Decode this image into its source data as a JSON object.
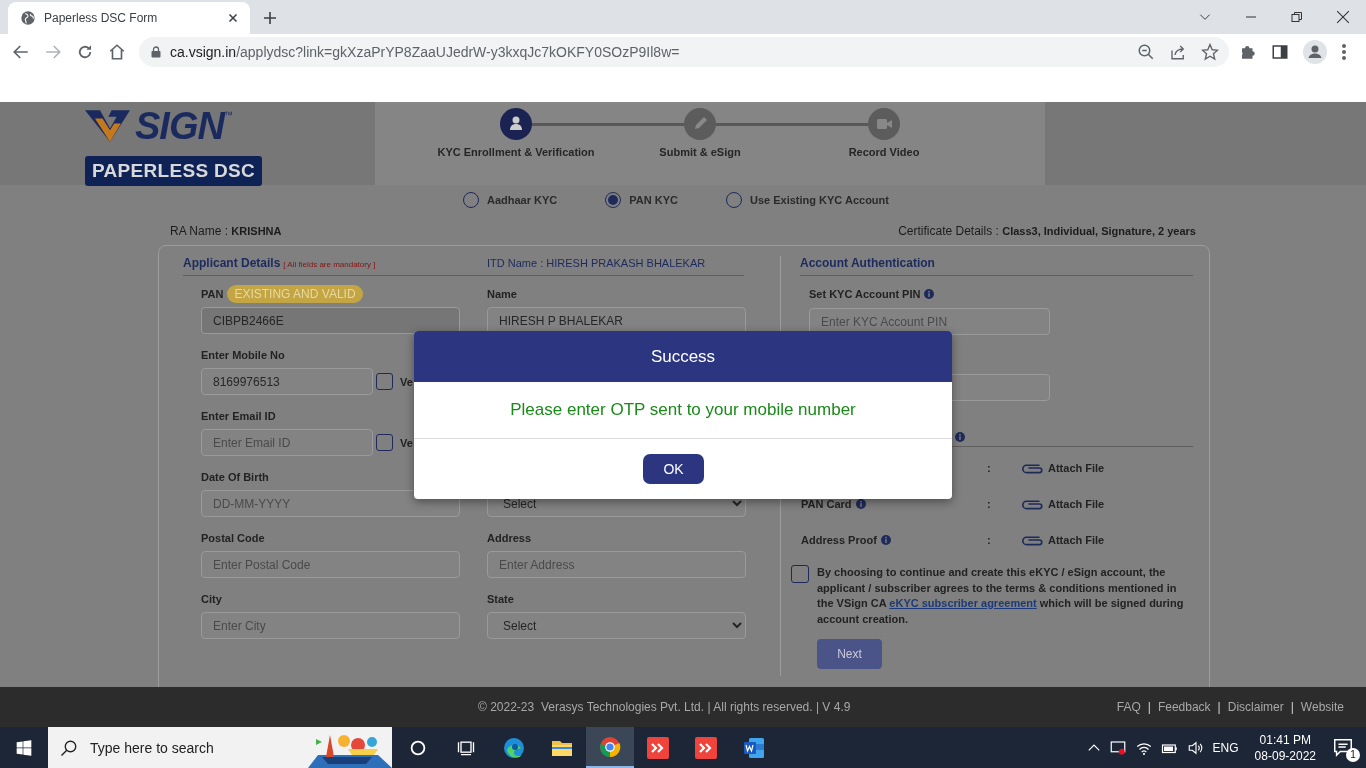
{
  "browser": {
    "tab_title": "Paperless DSC Form",
    "url_host": "ca.vsign.in",
    "url_path": "/applydsc?link=gkXzaPrYP8ZaaUJedrW-y3kxqJc7kOKFY0SOzP9Il8w="
  },
  "logo": {
    "word": "SIGN",
    "trademark": "™",
    "tagline": "PAPERLESS DSC"
  },
  "steps": [
    {
      "kind": "person",
      "label": "KYC Enrollment & Verification",
      "active": true
    },
    {
      "kind": "pencil",
      "label": "Submit & eSign",
      "active": false
    },
    {
      "kind": "camera",
      "label": "Record Video",
      "active": false
    }
  ],
  "kyc_options": [
    {
      "label": "Aadhaar KYC",
      "selected": false
    },
    {
      "label": "PAN KYC",
      "selected": true
    },
    {
      "label": "Use Existing KYC Account",
      "selected": false
    }
  ],
  "ra": {
    "label": "RA Name : ",
    "value": "KRISHNA"
  },
  "certificate": {
    "label": "Certificate Details : ",
    "value": "Class3, Individual, Signature, 2 years"
  },
  "applicant": {
    "title": "Applicant Details",
    "note": "[ All fields are mandatory ]",
    "itd_label": "ITD Name : ",
    "itd_value": "HIRESH PRAKASH BHALEKAR"
  },
  "left_fields": [
    {
      "kind": "input",
      "label": "PAN",
      "badge": "EXISTING AND VALID",
      "value": "CIBPB2466E",
      "disabled": true
    },
    {
      "kind": "input",
      "label": "Enter Mobile No",
      "value": "8169976513",
      "disabled": false,
      "verify": {
        "label": "Ve",
        "checked": false
      }
    },
    {
      "kind": "input",
      "label": "Enter Email ID",
      "placeholder": "Enter Email ID",
      "disabled": false,
      "verify": {
        "label": "Ve",
        "checked": false
      }
    },
    {
      "kind": "input",
      "label": "Date Of Birth",
      "placeholder": "DD-MM-YYYY",
      "disabled": false
    },
    {
      "kind": "input",
      "label": "Postal Code",
      "placeholder": "Enter Postal Code",
      "disabled": false
    },
    {
      "kind": "input",
      "label": "City",
      "placeholder": "Enter City",
      "disabled": false
    }
  ],
  "right_fields": [
    {
      "kind": "input",
      "label": "Name",
      "value": "HIRESH P BHALEKAR",
      "disabled": false
    },
    {
      "kind": "select",
      "value": "Select"
    },
    {
      "kind": "input",
      "label": "Address",
      "placeholder": "Enter Address",
      "disabled": false
    },
    {
      "kind": "select",
      "label": "State",
      "value": "Select"
    }
  ],
  "account": {
    "title": "Account Authentication",
    "pin_label": "Set KYC Account PIN",
    "pin_placeholder": "Enter KYC Account PIN"
  },
  "documents": [
    {
      "separator": ":",
      "attach": "Attach File"
    },
    {
      "label": "PAN Card",
      "separator": ":",
      "attach": "Attach File"
    },
    {
      "label": "Address Proof",
      "separator": ":",
      "attach": "Attach File"
    }
  ],
  "consent": {
    "checked": false,
    "text": "By choosing to continue and create this eKYC / eSign account, the applicant / subscriber agrees to the terms & conditions mentioned in the VSign CA ",
    "link": "eKYC subscriber agreement",
    "text_after": " which will be signed during account creation."
  },
  "next_button": {
    "label": "Next",
    "disabled": true
  },
  "modal": {
    "title": "Success",
    "message": "Please enter OTP sent to your mobile number",
    "button": "OK"
  },
  "footer": {
    "copyright": "© 2022-23  Verasys Technologies Pvt. Ltd. | All rights reserved. | V 4.9",
    "items": [
      {
        "kind": "link",
        "text": "FAQ"
      },
      {
        "kind": "separator",
        "text": "|"
      },
      {
        "kind": "link",
        "text": "Feedback"
      },
      {
        "kind": "separator",
        "text": "|"
      },
      {
        "kind": "link",
        "text": "Disclaimer"
      },
      {
        "kind": "separator",
        "text": "|"
      },
      {
        "kind": "link",
        "text": "Website"
      }
    ]
  },
  "taskbar": {
    "search_placeholder": "Type here to search",
    "apps": [
      {
        "kind": "cortana",
        "active": false
      },
      {
        "kind": "taskview",
        "active": false
      },
      {
        "kind": "edge",
        "active": false
      },
      {
        "kind": "explorer",
        "active": false
      },
      {
        "kind": "chrome",
        "active": true
      },
      {
        "kind": "remote",
        "active": false
      },
      {
        "kind": "remote",
        "active": false
      },
      {
        "kind": "word",
        "active": false
      }
    ],
    "language": "ENG",
    "time": "01:41 PM",
    "date": "08-09-2022",
    "notifications": "1"
  }
}
